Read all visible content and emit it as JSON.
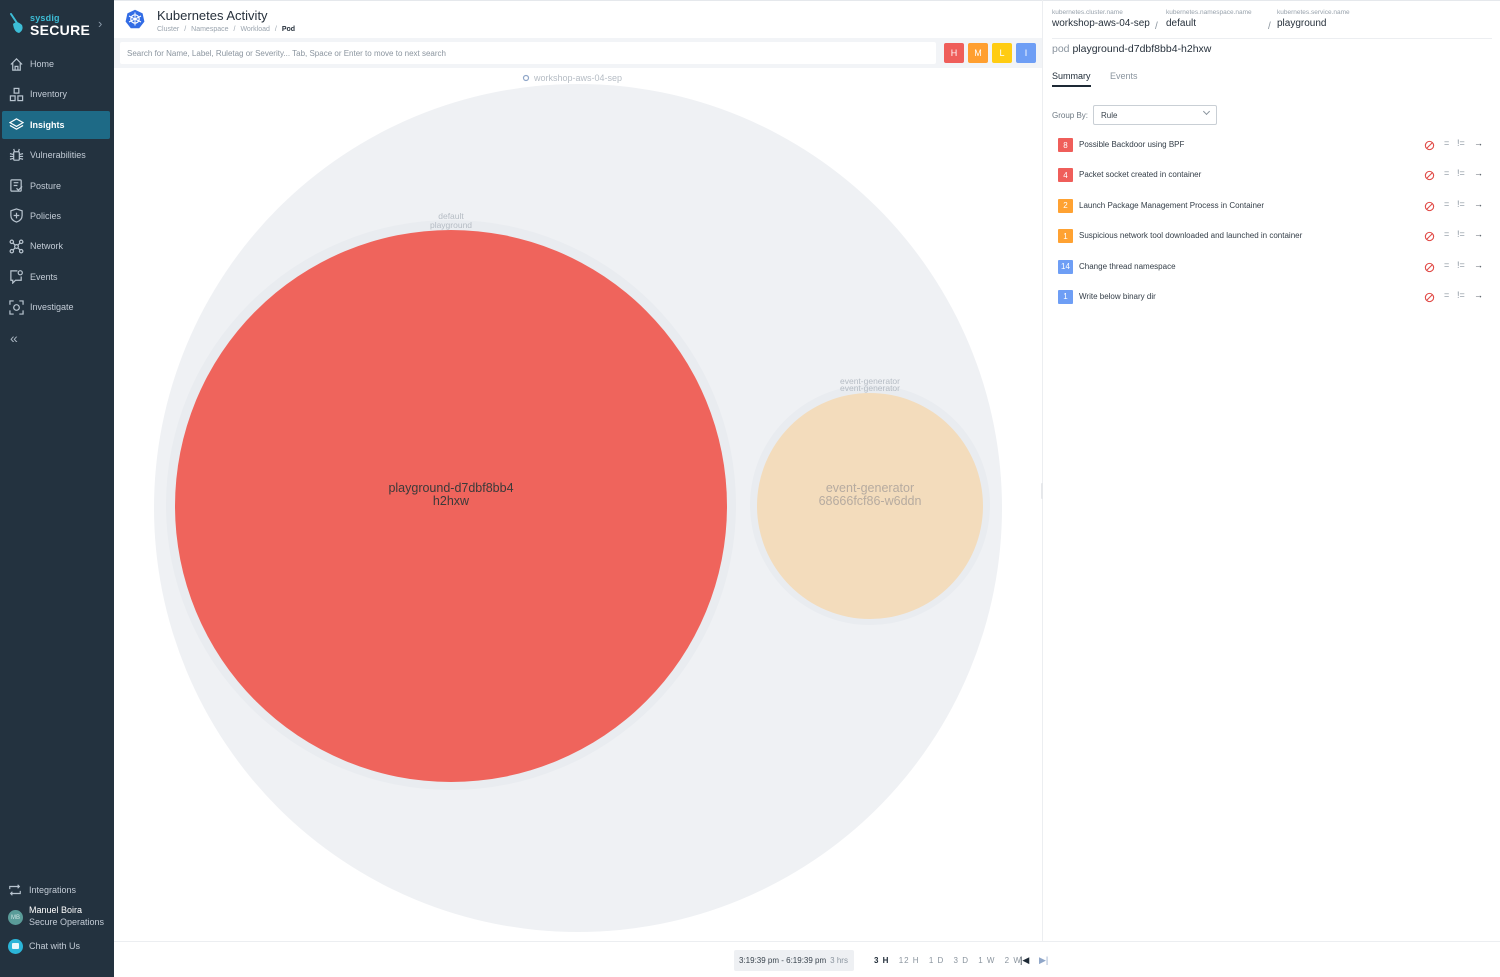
{
  "brand": {
    "small": "sysdig",
    "big": "SECURE"
  },
  "sidebar": {
    "items": [
      {
        "label": "Home",
        "icon": "home-icon",
        "active": false
      },
      {
        "label": "Inventory",
        "icon": "inventory-icon",
        "active": false
      },
      {
        "label": "Insights",
        "icon": "insights-icon",
        "active": true
      },
      {
        "label": "Vulnerabilities",
        "icon": "bug-icon",
        "active": false
      },
      {
        "label": "Posture",
        "icon": "posture-icon",
        "active": false
      },
      {
        "label": "Policies",
        "icon": "shield-icon",
        "active": false
      },
      {
        "label": "Network",
        "icon": "network-icon",
        "active": false
      },
      {
        "label": "Events",
        "icon": "events-icon",
        "active": false
      },
      {
        "label": "Investigate",
        "icon": "investigate-icon",
        "active": false
      }
    ],
    "collapse_icon": "double-chevron-left-icon",
    "integrations_label": "Integrations",
    "user": {
      "initials": "MB",
      "name": "Manuel Boira",
      "role": "Secure Operations"
    },
    "chat_label": "Chat with Us"
  },
  "header": {
    "title": "Kubernetes Activity",
    "breadcrumb": [
      "Cluster",
      "Namespace",
      "Workload",
      "Pod"
    ]
  },
  "search": {
    "placeholder": "Search for Name, Label, Ruletag or Severity... Tab, Space or Enter to move to next search"
  },
  "severity_filters": [
    {
      "label": "H",
      "color": "#ef5e5a"
    },
    {
      "label": "M",
      "color": "#ff9f30"
    },
    {
      "label": "L",
      "color": "#ffcc12"
    },
    {
      "label": "I",
      "color": "#6e9ef5"
    }
  ],
  "bubbles": {
    "cluster": {
      "label": "workshop-aws-04-sep",
      "color": "#eff1f4"
    },
    "namespace_workload": {
      "label1": "default",
      "label2": "playground"
    },
    "pods": [
      {
        "name_line1": "playground-d7dbf8bb4",
        "name_line2": "h2hxw",
        "color": "#ef645c",
        "text_color": "#3a3a3a",
        "group1": "default",
        "group2": "playground"
      },
      {
        "name_line1": "event-generator",
        "name_line2": "68666fcf86-w6ddn",
        "color": "#f3dcbc",
        "text_color": "#b6aba0",
        "group1": "event-generator",
        "group2": "event-generator"
      }
    ]
  },
  "panel": {
    "scope": [
      {
        "key": "kubernetes.cluster.name",
        "value": "workshop-aws-04-sep"
      },
      {
        "key": "kubernetes.namespace.name",
        "value": "default"
      },
      {
        "key": "kubernetes.service.name",
        "value": "playground"
      }
    ],
    "pod_kind": "pod",
    "pod_name": "playground-d7dbf8bb4-h2hxw",
    "tabs": [
      {
        "label": "Summary",
        "active": true
      },
      {
        "label": "Events",
        "active": false
      }
    ],
    "group_by_label": "Group By:",
    "group_by_value": "Rule",
    "rules": [
      {
        "count": "8",
        "name": "Possible Backdoor using BPF",
        "severity": "high",
        "color": "#ef5e5a"
      },
      {
        "count": "4",
        "name": "Packet socket created in container",
        "severity": "high",
        "color": "#ef5e5a"
      },
      {
        "count": "2",
        "name": "Launch Package Management Process in Container",
        "severity": "medium",
        "color": "#ffa232"
      },
      {
        "count": "1",
        "name": "Suspicious network tool downloaded and launched in container",
        "severity": "medium",
        "color": "#ffa232"
      },
      {
        "count": "14",
        "name": "Change thread namespace",
        "severity": "info",
        "color": "#6e9ef5"
      },
      {
        "count": "1",
        "name": "Write below binary dir",
        "severity": "info",
        "color": "#6e9ef5"
      }
    ],
    "rule_actions": {
      "eq": "=",
      "neq": "!=",
      "go": "→"
    }
  },
  "timebar": {
    "range": "3:19:39 pm - 6:19:39 pm",
    "duration": "3 hrs",
    "presets": [
      {
        "label": "3 H",
        "active": true
      },
      {
        "label": "12 H",
        "active": false
      },
      {
        "label": "1 D",
        "active": false
      },
      {
        "label": "3 D",
        "active": false
      },
      {
        "label": "1 W",
        "active": false
      },
      {
        "label": "2 W",
        "active": false
      }
    ]
  }
}
